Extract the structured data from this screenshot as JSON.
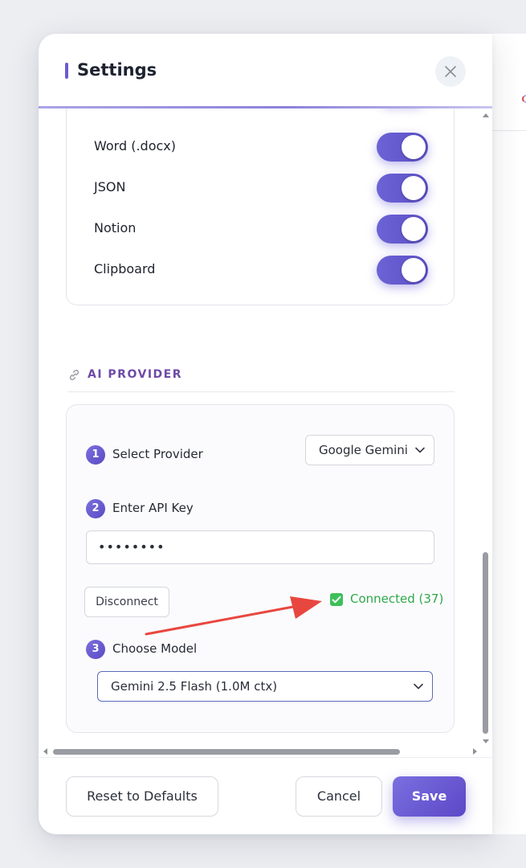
{
  "header": {
    "title": "Settings"
  },
  "export_toggles": [
    {
      "label": "Word (.docx)",
      "enabled": true
    },
    {
      "label": "JSON",
      "enabled": true
    },
    {
      "label": "Notion",
      "enabled": true
    },
    {
      "label": "Clipboard",
      "enabled": true
    }
  ],
  "ai_provider": {
    "section_title": "AI PROVIDER",
    "steps": [
      {
        "number": "1",
        "label": "Select Provider"
      },
      {
        "number": "2",
        "label": "Enter API Key"
      },
      {
        "number": "3",
        "label": "Choose Model"
      }
    ],
    "provider_select": {
      "value": "Google Gemini"
    },
    "api_key": {
      "value": "••••••••"
    },
    "disconnect_label": "Disconnect",
    "status_text": "Connected (37)",
    "model_select": {
      "value": "Gemini 2.5 Flash (1.0M ctx)"
    }
  },
  "footer": {
    "reset_label": "Reset to Defaults",
    "cancel_label": "Cancel",
    "save_label": "Save"
  },
  "colors": {
    "accent": "#6c63d6",
    "section_title": "#6e4aa8",
    "connected": "#2fa84a",
    "annotation_arrow": "#e8473f"
  },
  "icons": [
    "close-icon",
    "link-icon",
    "chevron-down-icon",
    "checkbox-checked-icon",
    "scroll-arrow-icon"
  ]
}
